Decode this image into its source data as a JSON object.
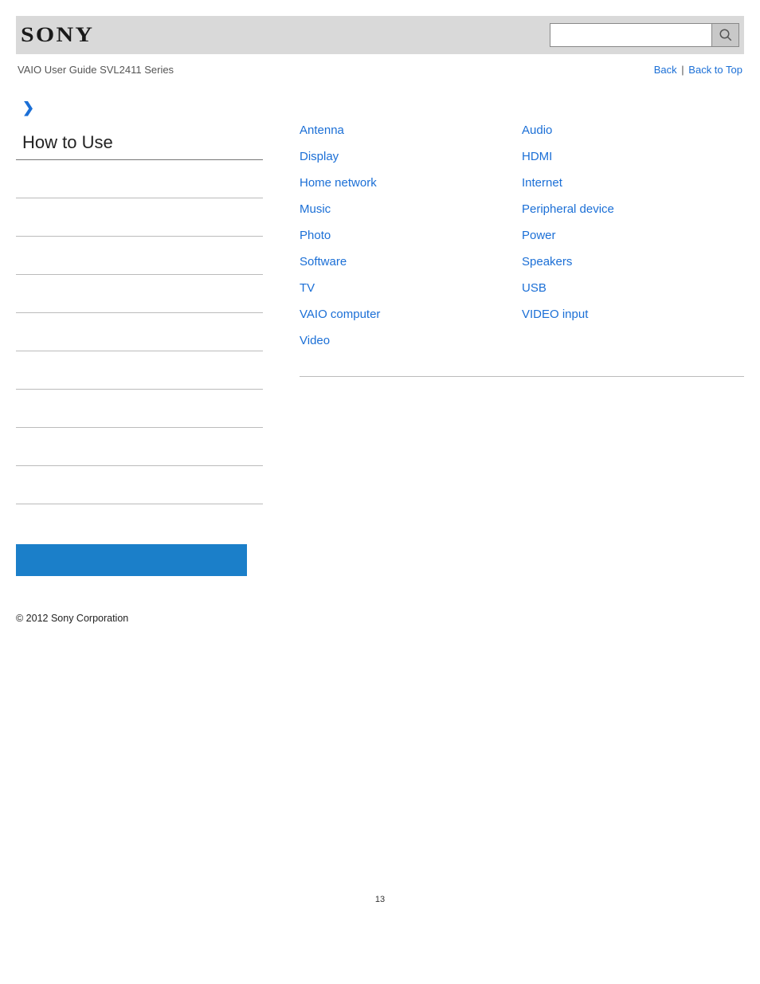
{
  "header": {
    "logo_text": "SONY",
    "search_placeholder": ""
  },
  "subheader": {
    "guide_title": "VAIO User Guide SVL2411 Series",
    "back_label": "Back",
    "back_to_top_label": "Back to Top",
    "separator": "|"
  },
  "sidebar": {
    "section_title": "How to Use"
  },
  "main_links": {
    "col1": [
      "Antenna",
      "Display",
      "Home network",
      "Music",
      "Photo",
      "Software",
      "TV",
      "VAIO computer",
      "Video"
    ],
    "col2": [
      "Audio",
      "HDMI",
      "Internet",
      "Peripheral device",
      "Power",
      "Speakers",
      "USB",
      "VIDEO input"
    ]
  },
  "footer": {
    "copyright": "© 2012 Sony Corporation",
    "page_number": "13"
  }
}
